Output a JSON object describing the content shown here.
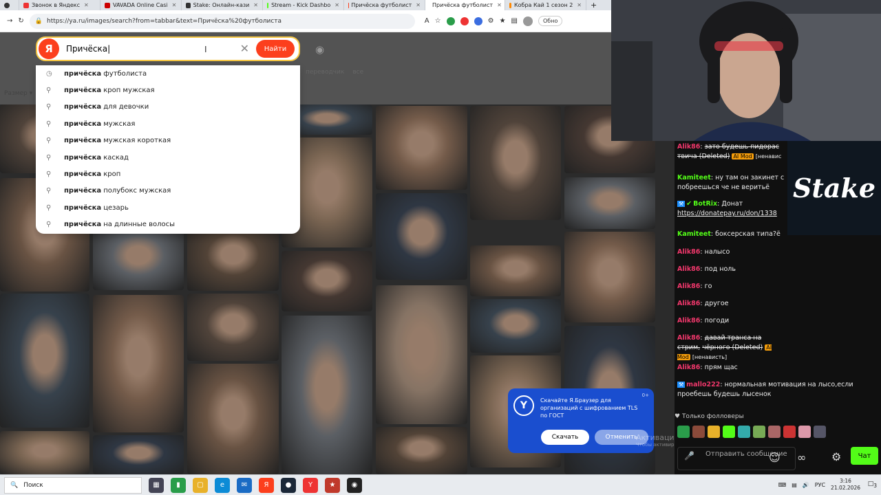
{
  "tabs": [
    {
      "label": "Звонок в Яндекс",
      "color": "#e33"
    },
    {
      "label": "VAVADA Online Casi",
      "color": "#c00"
    },
    {
      "label": "Stake: Онлайн-кази",
      "color": "#333"
    },
    {
      "label": "Stream - Kick Dashbo",
      "color": "#53fc18"
    },
    {
      "label": "Причёска футболист",
      "color": "#fc3f1d"
    },
    {
      "label": "Причёска футболист",
      "color": "#f5c400"
    },
    {
      "label": "Кобра Кай 1 сезон 2",
      "color": "#f80"
    }
  ],
  "address": {
    "url": "https://ya.ru/images/search?from=tabbar&text=Причёска%20футболиста",
    "update_label": "Обно"
  },
  "search": {
    "logo": "Я",
    "query": "Причёска",
    "find_label": "Найти"
  },
  "suggestions": [
    {
      "bold": "причёска",
      "rest": "футболиста",
      "icon": "history"
    },
    {
      "bold": "причёска",
      "rest": "кроп мужская",
      "icon": "search"
    },
    {
      "bold": "причёска",
      "rest": "для девочки",
      "icon": "search"
    },
    {
      "bold": "причёска",
      "rest": "мужская",
      "icon": "search"
    },
    {
      "bold": "причёска",
      "rest": "мужская короткая",
      "icon": "search"
    },
    {
      "bold": "причёска",
      "rest": "каскад",
      "icon": "search"
    },
    {
      "bold": "причёска",
      "rest": "кроп",
      "icon": "search"
    },
    {
      "bold": "причёска",
      "rest": "полубокс мужская",
      "icon": "search"
    },
    {
      "bold": "причёска",
      "rest": "цезарь",
      "icon": "search"
    },
    {
      "bold": "причёска",
      "rest": "на длинные волосы",
      "icon": "search"
    }
  ],
  "nav": {
    "translator": "переводчик",
    "all": "все",
    "size": "Размер"
  },
  "toast": {
    "logo": "Y",
    "message": "Скачайте Я.Браузер для организаций с шифрованием TLS по ГОСТ",
    "count": "0+",
    "download": "Скачать",
    "cancel": "Отменить"
  },
  "watermark": {
    "title": "Активация Windows",
    "sub": "Чтобы активировать Windows, перейдите в раздел \"Параметры\"."
  },
  "chat": [
    {
      "user": "Alik86",
      "color": "#f0376b",
      "text": "зато будешь пидорас",
      "extra": "твича (Deleted)",
      "badge": "AI Mod",
      "tail": "[ненавис",
      "strike": true
    },
    {
      "user": "Kamiteet",
      "color": "#53fc18",
      "text": "ну там он закинет с",
      "extra": "побреешься че не веритьё",
      "strike": false
    },
    {
      "user": "BotRix",
      "color": "#53fc18",
      "text": "Донат",
      "extra": "https://donatepay.ru/don/1338",
      "strike": false
    },
    {
      "user": "Kamiteet",
      "color": "#53fc18",
      "text": "боксерская типа?ё",
      "strike": false
    },
    {
      "user": "Alik86",
      "color": "#f0376b",
      "text": "налысо",
      "strike": false
    },
    {
      "user": "Alik86",
      "color": "#f0376b",
      "text": "под ноль",
      "strike": false
    },
    {
      "user": "Alik86",
      "color": "#f0376b",
      "text": "го",
      "strike": false
    },
    {
      "user": "Alik86",
      "color": "#f0376b",
      "text": "другое",
      "strike": false
    },
    {
      "user": "Alik86",
      "color": "#f0376b",
      "text": "погоди",
      "strike": false
    },
    {
      "user": "Alik86",
      "color": "#f0376b",
      "text": "давай транса на стрим,",
      "extra": "чёрного (Deleted)",
      "badge": "AI Mod",
      "tail": "[ненависть]",
      "strike": true
    },
    {
      "user": "Alik86",
      "color": "#f0376b",
      "text": "прям щас",
      "strike": false
    },
    {
      "user": "mallo222",
      "color": "#f0376b",
      "text": "нормальная мотивация на лысо,если",
      "extra": "проебешь будешь лысенок",
      "strike": false
    }
  ],
  "followers_only": "Только фолловеры",
  "chat_input": {
    "placeholder": "Отправить сообщение",
    "send": "Чат"
  },
  "stake_logo": "Stake",
  "taskbar": {
    "search": "Поиск",
    "lang": "РУС",
    "time": "3:16",
    "date": "21.02.2026",
    "notif": "3"
  }
}
